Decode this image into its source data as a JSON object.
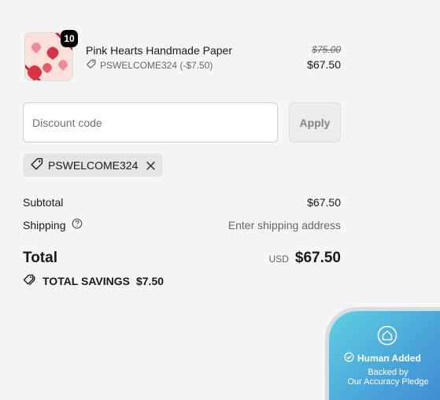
{
  "product": {
    "name": "Pink Hearts Handmade Paper",
    "quantity": "10",
    "discount_line": "PSWELCOME324 (-$7.50)",
    "original_price": "$75.00",
    "price": "$67.50"
  },
  "discount": {
    "placeholder": "Discount code",
    "apply_label": "Apply",
    "applied_code": "PSWELCOME324"
  },
  "totals": {
    "subtotal_label": "Subtotal",
    "subtotal_value": "$67.50",
    "shipping_label": "Shipping",
    "shipping_value": "Enter shipping address",
    "total_label": "Total",
    "currency": "USD",
    "total_value": "$67.50",
    "savings_label": "TOTAL SAVINGS",
    "savings_value": "$7.50"
  },
  "pledge_badge": {
    "title": "Human Added",
    "line1": "Backed by",
    "line2": "Our Accuracy Pledge"
  },
  "colors": {
    "background": "#f5f5f5",
    "quantity_badge": "#000000",
    "apply_button": "#ececec",
    "chip": "#e6e6e6",
    "badge_gradient_start": "#5fd0e3",
    "badge_gradient_end": "#3f86cf"
  },
  "icons": [
    "tag-icon",
    "close-icon",
    "help-circle-icon",
    "tags-icon",
    "home-icon",
    "check-circle-icon"
  ]
}
